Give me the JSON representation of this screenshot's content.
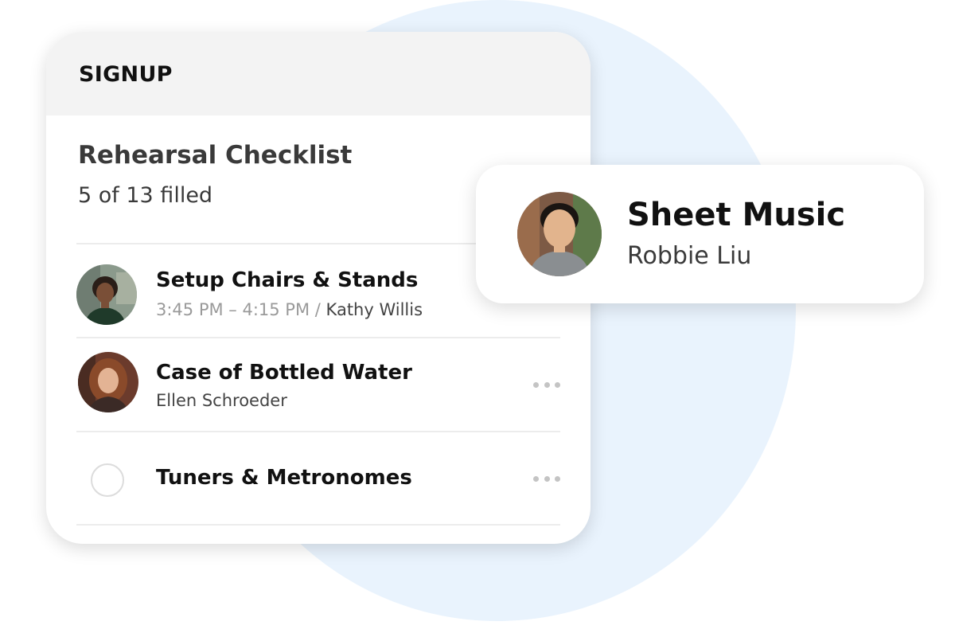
{
  "signup": {
    "header_title": "SIGNUP",
    "checklist_title": "Rehearsal Checklist",
    "filled_count": "5 of 13 filled",
    "items": [
      {
        "title": "Setup Chairs & Stands",
        "time": "3:45 PM – 4:15 PM",
        "separator": "/",
        "person": "Kathy Willis",
        "avatar": "student-photo-avatar"
      },
      {
        "title": "Case of Bottled Water",
        "person": "Ellen Schroeder",
        "avatar": "student-photo-avatar"
      },
      {
        "title": "Tuners & Metronomes",
        "status": "empty"
      }
    ]
  },
  "popup": {
    "title": "Sheet Music",
    "person": "Robbie Liu",
    "avatar": "student-photo-avatar"
  },
  "colors": {
    "background_circle": "#e9f3fd",
    "header_bg": "#f3f3f3",
    "title_text": "#111111",
    "muted_text": "#9a9a9a"
  }
}
